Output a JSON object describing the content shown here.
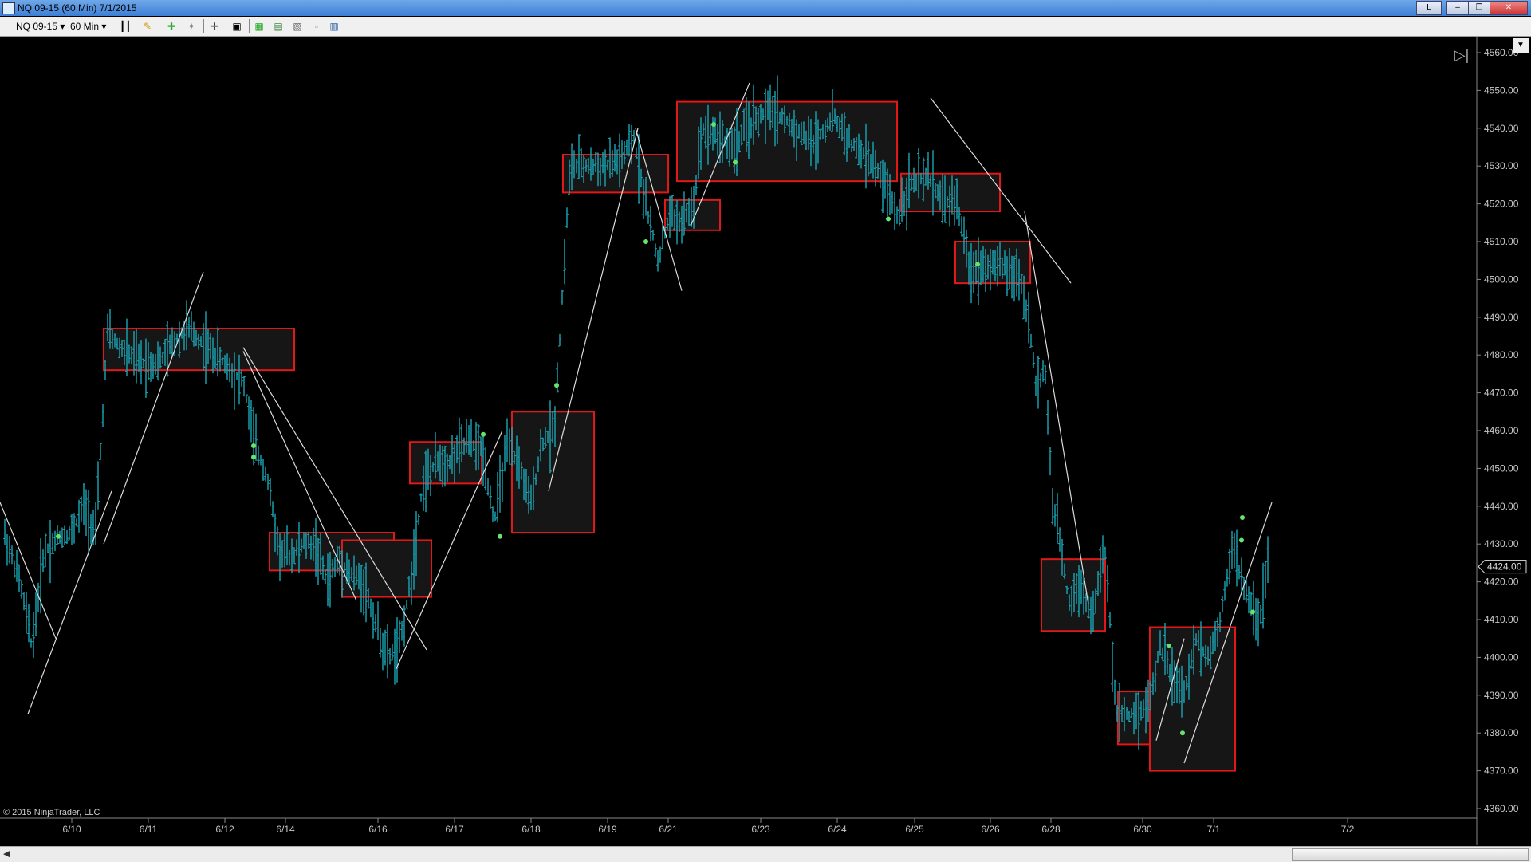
{
  "window": {
    "title": "NQ 09-15 (60 Min)  7/1/2015",
    "btn_layout": "L",
    "btn_minimize": "‒",
    "btn_restore": "❐",
    "btn_close": "✕"
  },
  "toolbar": {
    "instrument": "NQ 09-15",
    "interval": "60 Min",
    "icons": [
      "bar-type-icon",
      "pencil-draw-icon",
      "indicator-icon",
      "strategy-icon",
      "crosshair-icon",
      "data-box-icon",
      "chart-trader-icon",
      "properties-icon",
      "template-icon",
      "copy-icon",
      "layout-icon"
    ]
  },
  "copyright": "© 2015 NinjaTrader, LLC",
  "colors": {
    "background": "#000000",
    "bar": "#1aa6b4",
    "box": "#e01818",
    "trendline": "#dddddd",
    "dot": "#6be36b",
    "axis_text": "#c8c8c8"
  },
  "chart_data": {
    "type": "ohlc-bar",
    "y_axis_labels": [
      "4560.00",
      "4550.00",
      "4540.00",
      "4530.00",
      "4520.00",
      "4510.00",
      "4500.00",
      "4490.00",
      "4480.00",
      "4470.00",
      "4460.00",
      "4450.00",
      "4440.00",
      "4430.00",
      "4420.00",
      "4410.00",
      "4400.00",
      "4390.00",
      "4380.00",
      "4370.00",
      "4360.00"
    ],
    "ylim": [
      4357,
      4564
    ],
    "current_price": "4424.00",
    "x_axis_labels": [
      "6/10",
      "6/11",
      "6/12",
      "6/14",
      "6/16",
      "6/17",
      "6/18",
      "6/19",
      "6/21",
      "6/23",
      "6/24",
      "6/25",
      "6/26",
      "6/28",
      "6/30",
      "7/1",
      "7/2"
    ],
    "price_path": [
      [
        0,
        4436
      ],
      [
        25,
        4420
      ],
      [
        40,
        4403
      ],
      [
        55,
        4428
      ],
      [
        75,
        4432
      ],
      [
        90,
        4433
      ],
      [
        105,
        4440
      ],
      [
        120,
        4433
      ],
      [
        135,
        4486
      ],
      [
        150,
        4482
      ],
      [
        175,
        4478
      ],
      [
        200,
        4478
      ],
      [
        220,
        4484
      ],
      [
        235,
        4487
      ],
      [
        255,
        4483
      ],
      [
        270,
        4480
      ],
      [
        290,
        4476
      ],
      [
        305,
        4473
      ],
      [
        320,
        4456
      ],
      [
        335,
        4448
      ],
      [
        350,
        4428
      ],
      [
        365,
        4427
      ],
      [
        380,
        4430
      ],
      [
        395,
        4430
      ],
      [
        410,
        4420
      ],
      [
        425,
        4426
      ],
      [
        440,
        4422
      ],
      [
        455,
        4420
      ],
      [
        470,
        4410
      ],
      [
        485,
        4400
      ],
      [
        500,
        4402
      ],
      [
        515,
        4420
      ],
      [
        530,
        4446
      ],
      [
        550,
        4452
      ],
      [
        565,
        4452
      ],
      [
        585,
        4457
      ],
      [
        605,
        4455
      ],
      [
        620,
        4436
      ],
      [
        635,
        4455
      ],
      [
        650,
        4452
      ],
      [
        665,
        4440
      ],
      [
        680,
        4457
      ],
      [
        695,
        4460
      ],
      [
        705,
        4495
      ],
      [
        715,
        4530
      ],
      [
        735,
        4530
      ],
      [
        760,
        4530
      ],
      [
        780,
        4532
      ],
      [
        795,
        4537
      ],
      [
        810,
        4520
      ],
      [
        825,
        4505
      ],
      [
        840,
        4517
      ],
      [
        855,
        4515
      ],
      [
        870,
        4520
      ],
      [
        880,
        4540
      ],
      [
        900,
        4538
      ],
      [
        920,
        4535
      ],
      [
        945,
        4542
      ],
      [
        970,
        4545
      ],
      [
        995,
        4540
      ],
      [
        1020,
        4536
      ],
      [
        1045,
        4543
      ],
      [
        1070,
        4535
      ],
      [
        1090,
        4532
      ],
      [
        1110,
        4525
      ],
      [
        1125,
        4517
      ],
      [
        1140,
        4525
      ],
      [
        1165,
        4527
      ],
      [
        1185,
        4520
      ],
      [
        1200,
        4521
      ],
      [
        1215,
        4503
      ],
      [
        1240,
        4504
      ],
      [
        1260,
        4503
      ],
      [
        1280,
        4500
      ],
      [
        1290,
        4490
      ],
      [
        1300,
        4470
      ],
      [
        1310,
        4478
      ],
      [
        1320,
        4440
      ],
      [
        1330,
        4430
      ],
      [
        1340,
        4415
      ],
      [
        1355,
        4420
      ],
      [
        1370,
        4410
      ],
      [
        1385,
        4430
      ],
      [
        1400,
        4385
      ],
      [
        1420,
        4385
      ],
      [
        1440,
        4387
      ],
      [
        1455,
        4403
      ],
      [
        1470,
        4395
      ],
      [
        1485,
        4390
      ],
      [
        1500,
        4405
      ],
      [
        1515,
        4400
      ],
      [
        1530,
        4410
      ],
      [
        1545,
        4430
      ],
      [
        1560,
        4418
      ],
      [
        1580,
        4410
      ],
      [
        1590,
        4425
      ]
    ],
    "boxes": [
      {
        "x1": 130,
        "x2": 369,
        "y_high": 4487,
        "y_low": 4476
      },
      {
        "x1": 338,
        "x2": 494,
        "y_high": 4433,
        "y_low": 4423
      },
      {
        "x1": 429,
        "x2": 541,
        "y_high": 4431,
        "y_low": 4416
      },
      {
        "x1": 514,
        "x2": 604,
        "y_high": 4457,
        "y_low": 4446
      },
      {
        "x1": 642,
        "x2": 745,
        "y_high": 4465,
        "y_low": 4433
      },
      {
        "x1": 706,
        "x2": 838,
        "y_high": 4533,
        "y_low": 4523
      },
      {
        "x1": 834,
        "x2": 903,
        "y_high": 4521,
        "y_low": 4513
      },
      {
        "x1": 849,
        "x2": 1125,
        "y_high": 4547,
        "y_low": 4526
      },
      {
        "x1": 1130,
        "x2": 1254,
        "y_high": 4528,
        "y_low": 4518
      },
      {
        "x1": 1198,
        "x2": 1292,
        "y_high": 4510,
        "y_low": 4499
      },
      {
        "x1": 1306,
        "x2": 1386,
        "y_high": 4426,
        "y_low": 4407
      },
      {
        "x1": 1402,
        "x2": 1470,
        "y_high": 4391,
        "y_low": 4377
      },
      {
        "x1": 1442,
        "x2": 1549,
        "y_high": 4408,
        "y_low": 4370
      }
    ],
    "trend_lines": [
      [
        [
          0,
          4441
        ],
        [
          70,
          4405
        ]
      ],
      [
        [
          35,
          4385
        ],
        [
          140,
          4444
        ]
      ],
      [
        [
          130,
          4430
        ],
        [
          255,
          4502
        ]
      ],
      [
        [
          305,
          4481
        ],
        [
          447,
          4415
        ]
      ],
      [
        [
          305,
          4482
        ],
        [
          535,
          4402
        ]
      ],
      [
        [
          497,
          4397
        ],
        [
          630,
          4460
        ]
      ],
      [
        [
          688,
          4444
        ],
        [
          800,
          4540
        ]
      ],
      [
        [
          797,
          4540
        ],
        [
          855,
          4497
        ]
      ],
      [
        [
          866,
          4514
        ],
        [
          940,
          4552
        ]
      ],
      [
        [
          1167,
          4548
        ],
        [
          1343,
          4499
        ]
      ],
      [
        [
          1285,
          4518
        ],
        [
          1365,
          4414
        ]
      ],
      [
        [
          1450,
          4378
        ],
        [
          1485,
          4405
        ]
      ],
      [
        [
          1485,
          4372
        ],
        [
          1595,
          4441
        ]
      ]
    ],
    "dots": [
      [
        73,
        4432
      ],
      [
        318,
        4456
      ],
      [
        318,
        4453
      ],
      [
        606,
        4459
      ],
      [
        627,
        4432
      ],
      [
        698,
        4472
      ],
      [
        810,
        4510
      ],
      [
        895,
        4541
      ],
      [
        922,
        4531
      ],
      [
        1114,
        4516
      ],
      [
        1226,
        4504
      ],
      [
        1466,
        4403
      ],
      [
        1483,
        4380
      ],
      [
        1558,
        4437
      ],
      [
        1557,
        4431
      ],
      [
        1571,
        4412
      ]
    ],
    "grid": false
  }
}
